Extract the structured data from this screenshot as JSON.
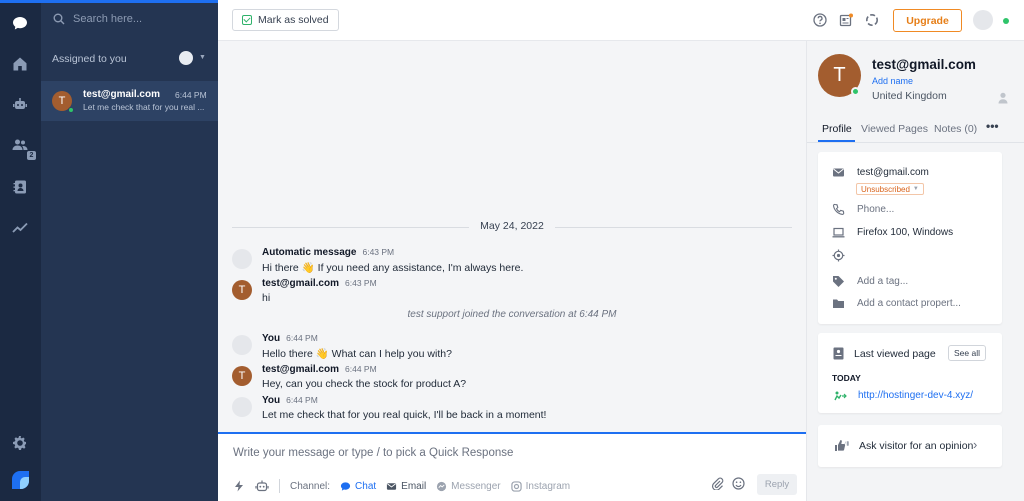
{
  "colors": {
    "accent": "#1e6ff1",
    "rail": "#1b2942",
    "list": "#243552",
    "upgrade": "#f08a24",
    "online": "#2fc46a",
    "avatar": "#a35d2f"
  },
  "rail": {
    "icons": [
      "chat-icon",
      "home-icon",
      "bot-icon",
      "team-icon",
      "contacts-icon",
      "analytics-icon",
      "settings-icon"
    ],
    "team_badge": "2"
  },
  "sidebar": {
    "search_placeholder": "Search here...",
    "assigned_label": "Assigned to you",
    "conversations": [
      {
        "avatar_letter": "T",
        "name": "test@gmail.com",
        "time": "6:44 PM",
        "preview": "Let me check that for you real ..."
      }
    ]
  },
  "toolbar": {
    "mark_solved_label": "Mark as solved",
    "upgrade_label": "Upgrade"
  },
  "chat": {
    "date_separator": "May 24, 2022",
    "messages": [
      {
        "sender": "Automatic message",
        "time": "6:43 PM",
        "text": "Hi there 👋 If you need any assistance, I'm always here.",
        "avatar": "grey"
      },
      {
        "sender": "test@gmail.com",
        "time": "6:43 PM",
        "text": "hi",
        "avatar": "T"
      },
      {
        "sender": "You",
        "time": "6:44 PM",
        "text": "Hello there 👋 What can I help you with?",
        "avatar": "grey"
      },
      {
        "sender": "test@gmail.com",
        "time": "6:44 PM",
        "text": "Hey, can you check the stock for product A?",
        "avatar": "T"
      },
      {
        "sender": "You",
        "time": "6:44 PM",
        "text": "Let me check that for you real quick, I'll be back in a moment!",
        "avatar": "grey"
      }
    ],
    "system_message": "test support joined the conversation at 6:44 PM"
  },
  "composer": {
    "placeholder": "Write your message or type / to pick a Quick Response",
    "channel_label": "Channel:",
    "channels": [
      "Chat",
      "Email",
      "Messenger",
      "Instagram"
    ],
    "reply_label": "Reply"
  },
  "profile": {
    "avatar_letter": "T",
    "name": "test@gmail.com",
    "add_name": "Add name",
    "country": "United Kingdom",
    "tabs": [
      "Profile",
      "Viewed Pages",
      "Notes (0)"
    ],
    "email": "test@gmail.com",
    "subscription": "Unsubscribed",
    "phone_placeholder": "Phone...",
    "browser": "Firefox 100, Windows",
    "tag_placeholder": "Add a tag...",
    "property_placeholder": "Add a contact propert...",
    "last_viewed_title": "Last viewed page",
    "see_all": "See all",
    "today": "TODAY",
    "last_url": "http://hostinger-dev-4.xyz/",
    "ask_opinion": "Ask visitor for an opinion"
  }
}
